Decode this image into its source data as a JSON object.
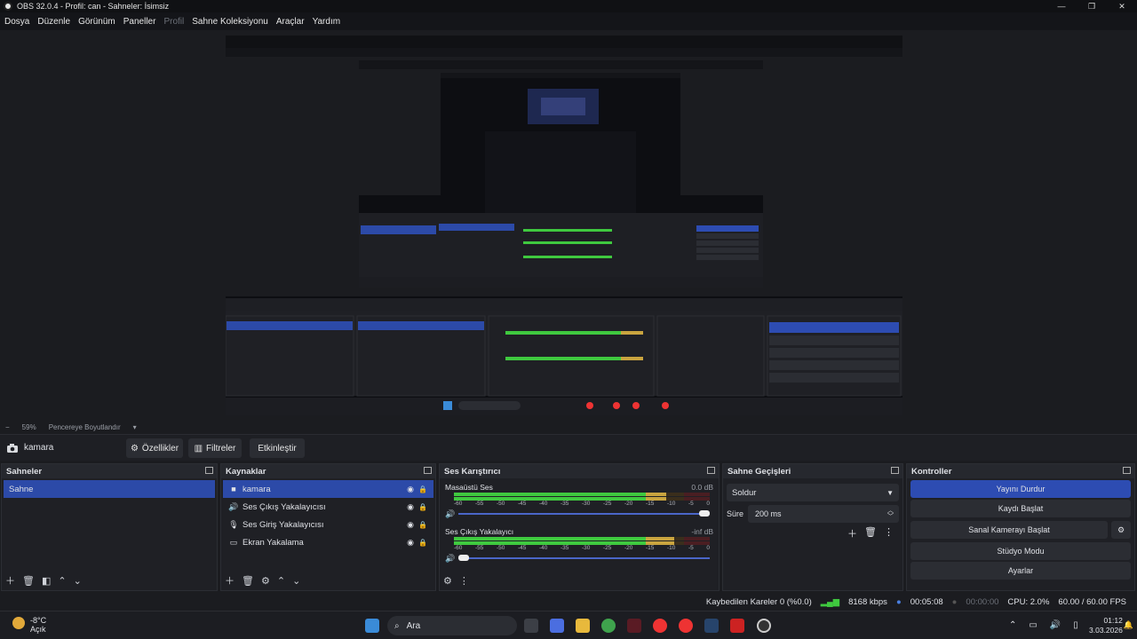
{
  "window": {
    "title": "OBS 32.0.4 - Profil: can - Sahneler: İsimsiz",
    "controls": [
      "—",
      "❐",
      "✕"
    ]
  },
  "menu": [
    "Dosya",
    "Düzenle",
    "Görünüm",
    "Paneller",
    "Profil",
    "Sahne Koleksiyonu",
    "Araçlar",
    "Yardım"
  ],
  "zoom": {
    "minus": "−",
    "value": "59%",
    "fit": "Pencereye Boyutlandır"
  },
  "source_toolbar": {
    "source": "kamara",
    "properties": "Özellikler",
    "filters": "Filtreler",
    "interact": "Etkinleştir"
  },
  "scenes": {
    "title": "Sahneler",
    "items": [
      "Sahne"
    ]
  },
  "sources": {
    "title": "Kaynaklar",
    "items": [
      "kamara",
      "Ses Çıkış Yakalayıcısı",
      "Ses Giriş Yakalayıcısı",
      "Ekran Yakalama"
    ]
  },
  "mixer": {
    "title": "Ses Karıştırıcı",
    "channels": [
      {
        "name": "Masaüstü Ses",
        "db": "0.0 dB",
        "level": 0.83,
        "volume": 1.0
      },
      {
        "name": "Ses Çıkış Yakalayıcı",
        "db": "-inf dB",
        "level": 0.86,
        "volume": 0.0
      }
    ],
    "ticks": [
      "-60",
      "-55",
      "-50",
      "-45",
      "-40",
      "-35",
      "-30",
      "-25",
      "-20",
      "-15",
      "-10",
      "-5",
      "0"
    ]
  },
  "transitions": {
    "title": "Sahne Geçişleri",
    "selected": "Soldur",
    "duration_label": "Süre",
    "duration": "200 ms"
  },
  "controls": {
    "title": "Kontroller",
    "buttons": [
      "Yayını Durdur",
      "Kaydı Başlat",
      "Sanal Kamerayı Başlat",
      "Stüdyo Modu",
      "Ayarlar"
    ]
  },
  "status": {
    "dropped": "Kaybedilen Kareler 0 (%0.0)",
    "bitrate": "8168 kbps",
    "stream_time": "00:05:08",
    "rec_time": "00:00:00",
    "cpu": "CPU: 2.0%",
    "fps": "60.00 / 60.00 FPS"
  },
  "taskbar": {
    "temp": "-8°C",
    "weather": "Açık",
    "search": "Ara",
    "time": "01:12",
    "date": "3.03.2026"
  },
  "colors": {
    "accent": "#2d4cb2",
    "meter_green": "#3fc93f",
    "meter_yellow": "#c9a43f",
    "meter_red": "#c93f3f"
  }
}
